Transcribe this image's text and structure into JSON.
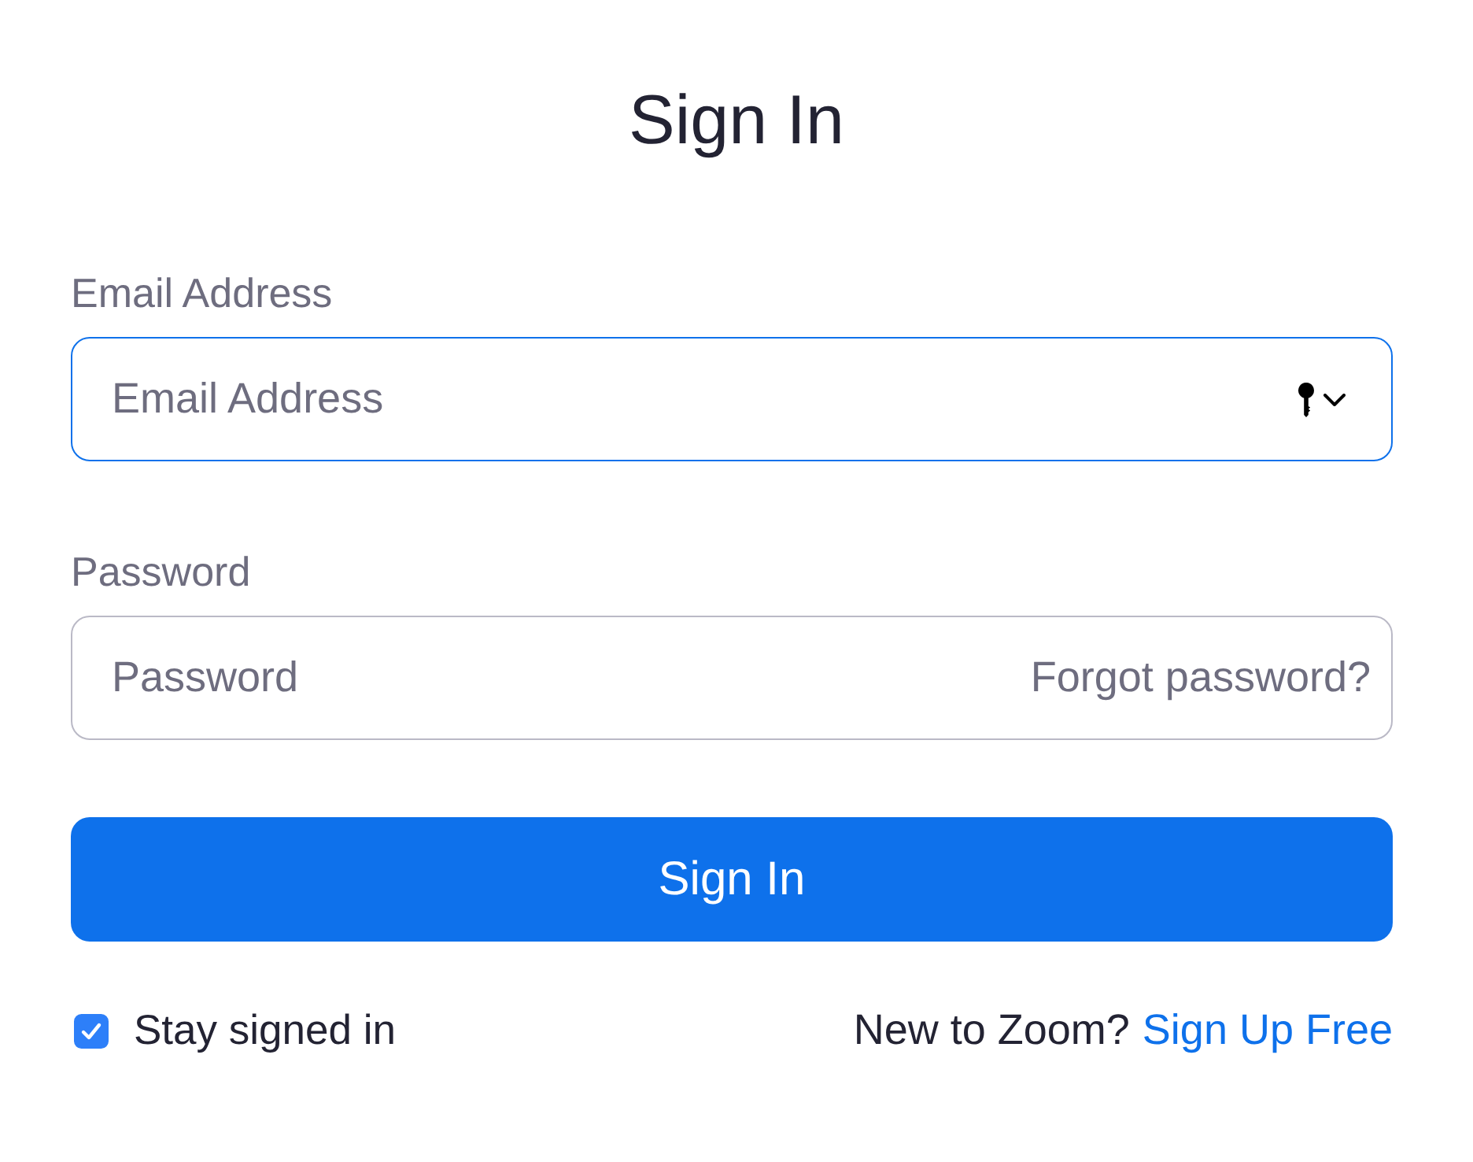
{
  "title": "Sign In",
  "fields": [
    {
      "kind": "email",
      "label": "Email Address",
      "placeholder": "Email Address",
      "focused": true
    },
    {
      "kind": "password",
      "label": "Password",
      "placeholder": "Password",
      "focused": false,
      "link": "Forgot password?"
    }
  ],
  "submit": "Sign In",
  "stay_signed_in": {
    "label": "Stay signed in",
    "checked": true
  },
  "signup": {
    "prompt": "New to Zoom?",
    "link": "Sign Up Free"
  }
}
